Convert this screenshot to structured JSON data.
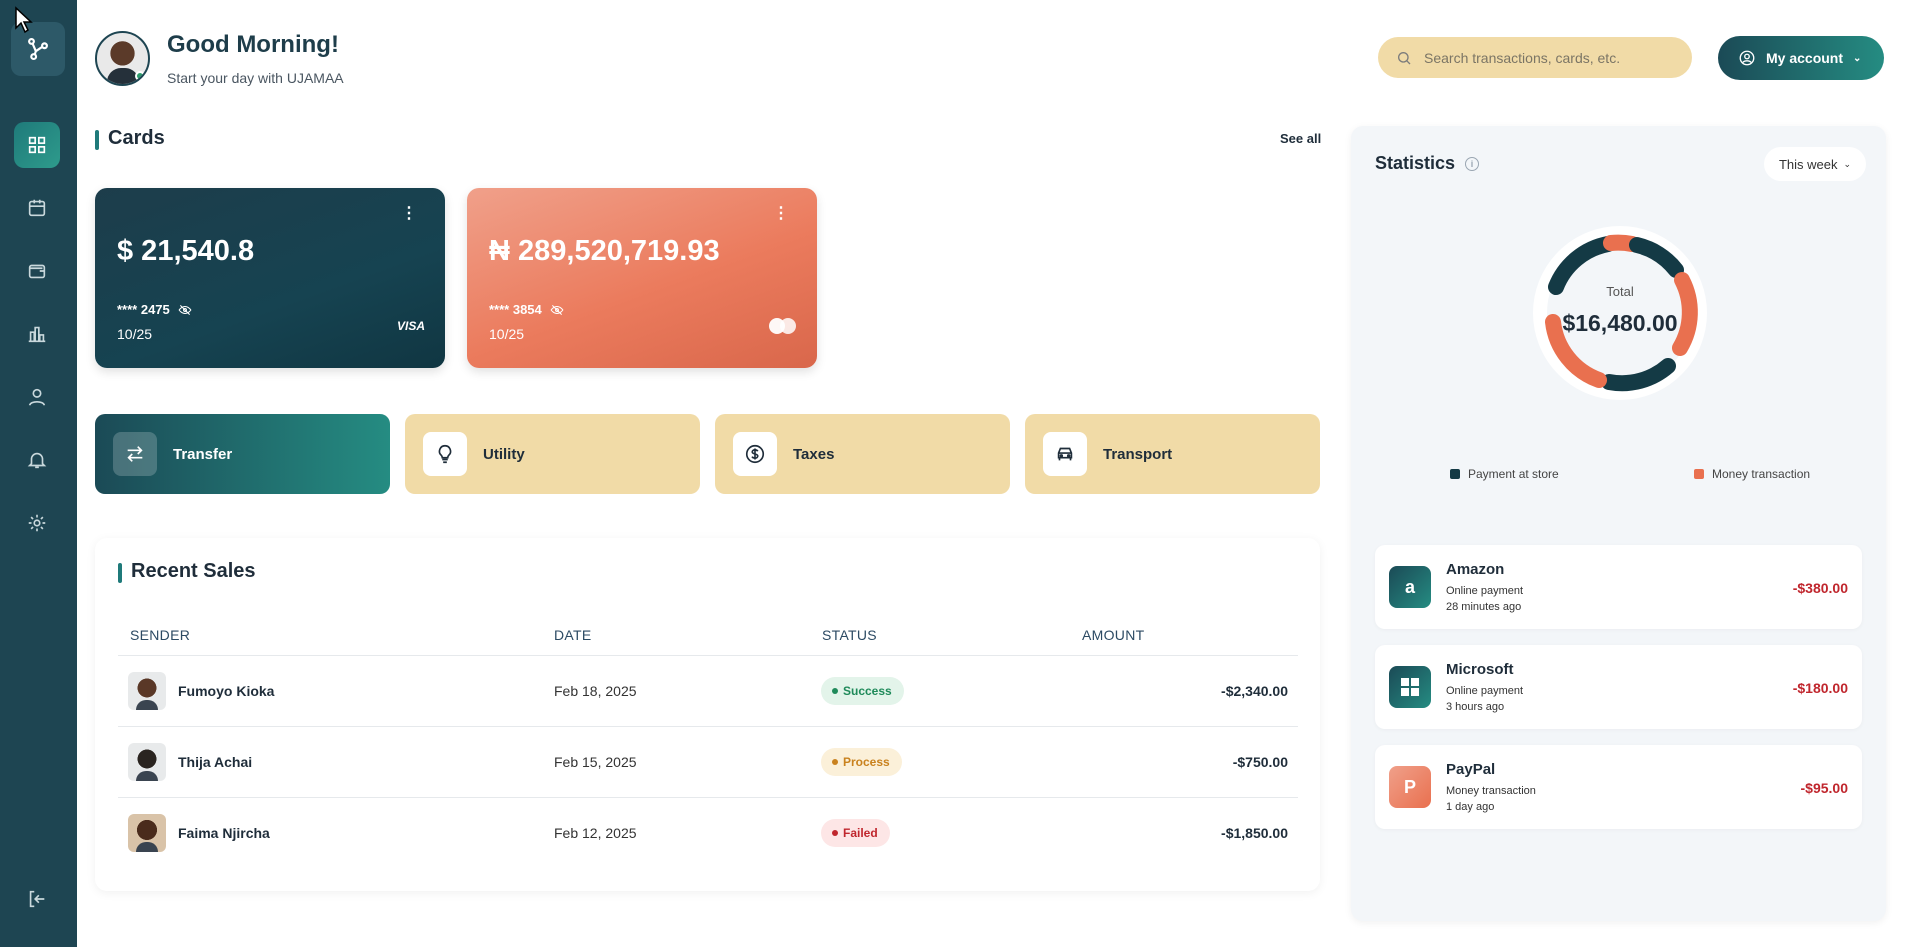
{
  "header": {
    "greeting": "Good Morning!",
    "subtitle": "Start your day with UJAMAA",
    "search_placeholder": "Search transactions, cards, etc.",
    "account_label": "My account"
  },
  "sidebar": {
    "items": [
      {
        "icon": "dashboard-icon",
        "active": true
      },
      {
        "icon": "calendar-icon",
        "active": false
      },
      {
        "icon": "wallet-icon",
        "active": false
      },
      {
        "icon": "bar-chart-icon",
        "active": false
      },
      {
        "icon": "user-icon",
        "active": false
      },
      {
        "icon": "bell-icon",
        "active": false
      },
      {
        "icon": "gear-icon",
        "active": false
      }
    ],
    "bottom_icon": "logout-icon"
  },
  "cards_section": {
    "title": "Cards",
    "see_all": "See all",
    "cards": [
      {
        "balance": "$ 21,540.8",
        "number": "**** 2475",
        "expiry": "10/25",
        "brand": "VISA",
        "style": "dark"
      },
      {
        "balance": "₦ 289,520,719.93",
        "number": "**** 3854",
        "expiry": "10/25",
        "brand": "mastercard-icon",
        "style": "coral"
      }
    ]
  },
  "actions": [
    {
      "label": "Transfer",
      "icon": "transfer-icon"
    },
    {
      "label": "Utility",
      "icon": "lightbulb-icon"
    },
    {
      "label": "Taxes",
      "icon": "dollar-circle-icon"
    },
    {
      "label": "Transport",
      "icon": "car-icon"
    }
  ],
  "recent_sales": {
    "title": "Recent Sales",
    "columns": [
      "SENDER",
      "DATE",
      "STATUS",
      "AMOUNT"
    ],
    "rows": [
      {
        "name": "Fumoyo Kioka",
        "date": "Feb 18, 2025",
        "status": "Success",
        "amount": "-$2,340.00"
      },
      {
        "name": "Thija Achai",
        "date": "Feb 15, 2025",
        "status": "Process",
        "amount": "-$750.00"
      },
      {
        "name": "Faima Njircha",
        "date": "Feb 12, 2025",
        "status": "Failed",
        "amount": "-$1,850.00"
      }
    ]
  },
  "statistics": {
    "title": "Statistics",
    "period": "This week",
    "total_label": "Total",
    "total_value": "$16,480.00",
    "legend": [
      {
        "label": "Payment at store",
        "color": "#143a45"
      },
      {
        "label": "Money transaction",
        "color": "#e9704f"
      }
    ],
    "transactions": [
      {
        "name": "Amazon",
        "type": "Online payment",
        "time": "28 minutes ago",
        "amount": "-$380.00",
        "icon": "amazon-icon"
      },
      {
        "name": "Microsoft",
        "type": "Online payment",
        "time": "3 hours ago",
        "amount": "-$180.00",
        "icon": "microsoft-icon"
      },
      {
        "name": "PayPal",
        "type": "Money transaction",
        "time": "1 day ago",
        "amount": "-$95.00",
        "icon": "paypal-icon"
      }
    ]
  },
  "colors": {
    "sidebar": "#1e4552",
    "accent": "#258c82",
    "sand": "#f1dba7",
    "coral": "#e9704f",
    "negative": "#c0262d",
    "success": "#1f8a5a",
    "process": "#c9821e",
    "failed": "#c0262d"
  }
}
